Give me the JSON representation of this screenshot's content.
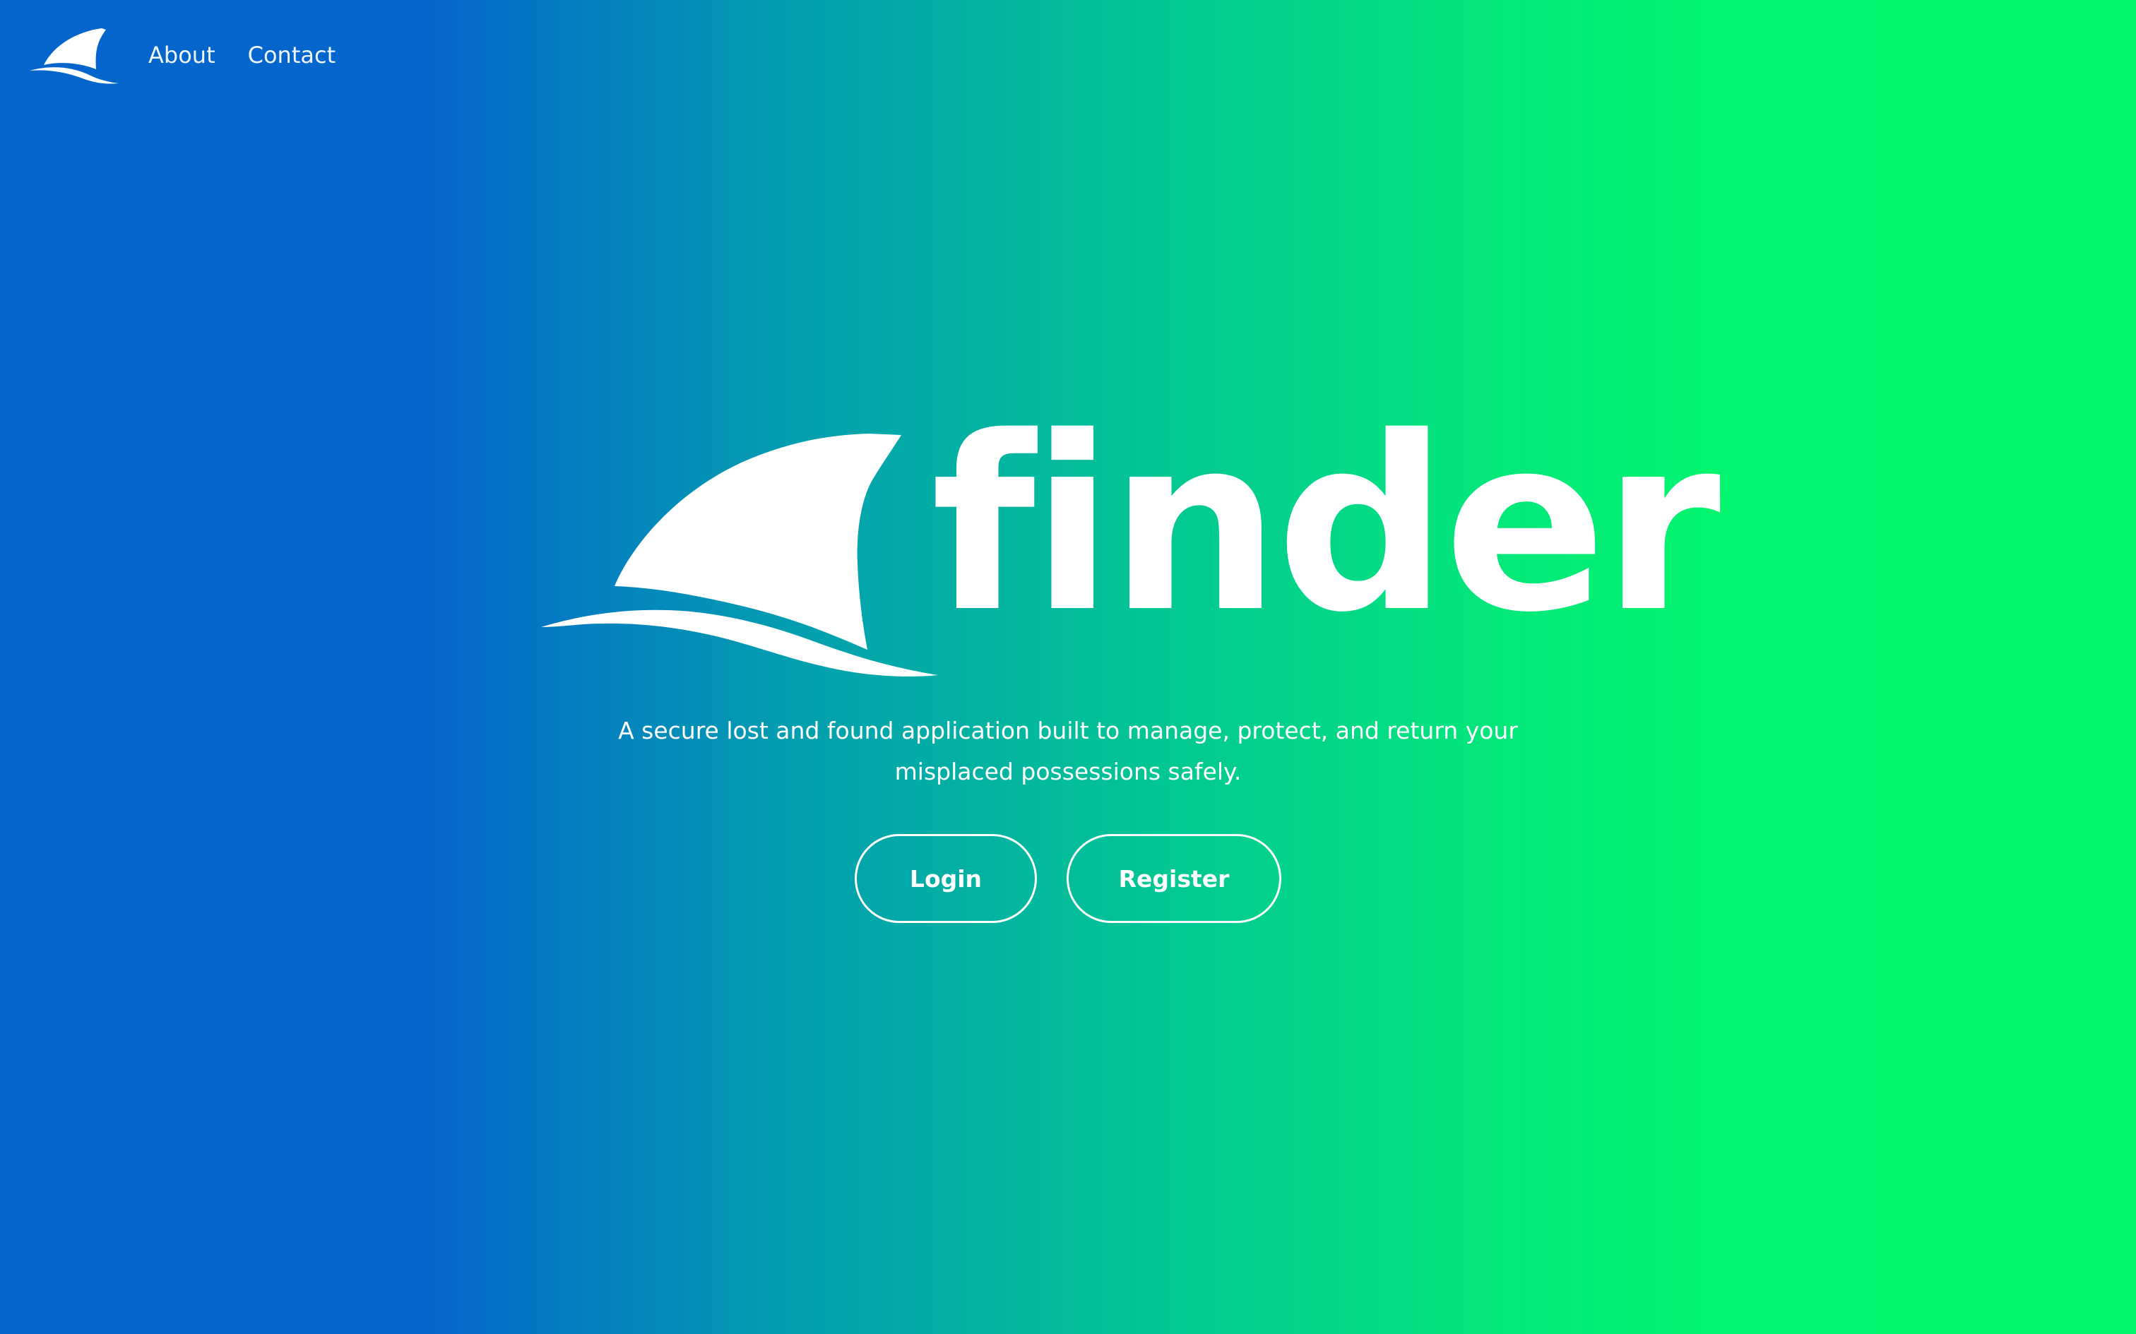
{
  "nav": {
    "logo_icon": "shark-fin-icon",
    "links": [
      {
        "label": "About"
      },
      {
        "label": "Contact"
      }
    ]
  },
  "hero": {
    "logo_icon": "shark-fin-wave-icon",
    "wordmark": "finder",
    "tagline_line1": "A secure lost and found application built to manage, protect, and return your",
    "tagline_line2": "misplaced possessions safely."
  },
  "actions": {
    "login_label": "Login",
    "register_label": "Register"
  },
  "colors": {
    "gradient_start": "#0466cc",
    "gradient_end": "#03f76e",
    "foreground": "#ffffff"
  }
}
